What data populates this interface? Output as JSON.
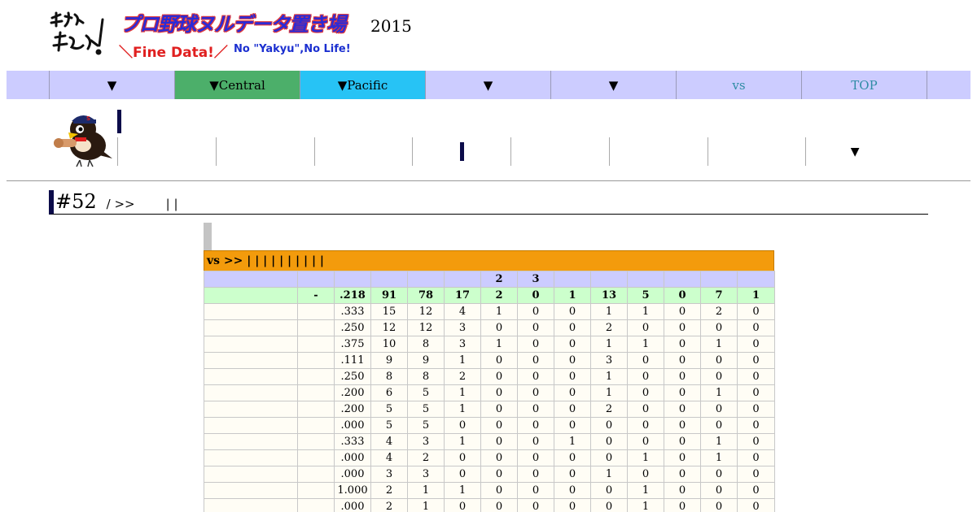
{
  "header": {
    "title": "プロ野球ヌルデータ置き場",
    "year": "2015",
    "slogan_fine": "＼Fine Data!／",
    "slogan_yakyu": "No \"Yakyu\",No Life!",
    "logo_icon": "calligraphy-logo"
  },
  "nav": {
    "items": [
      {
        "label": ""
      },
      {
        "label": "▼"
      },
      {
        "label": "▼Central",
        "color": "#4caf6a"
      },
      {
        "label": "▼Pacific",
        "color": "#27c3f5"
      },
      {
        "label": "▼"
      },
      {
        "label": "▼"
      },
      {
        "label": "vs"
      },
      {
        "label": "TOP"
      },
      {
        "label": ""
      }
    ]
  },
  "team_bar": {
    "mascot_icon": "swallow-mascot-icon",
    "tabs": [
      "",
      "",
      "",
      "",
      "",
      "",
      "",
      ""
    ],
    "dropdown_label": "▼"
  },
  "player": {
    "number": "#52",
    "sub": "/ >>",
    "links": "| |"
  },
  "table": {
    "caption": "vs >> | | | | | | | | | |",
    "header_row": [
      "",
      "",
      "",
      "",
      "",
      "",
      "2",
      "3",
      "",
      "",
      "",
      "",
      "",
      ""
    ],
    "total_row": [
      "",
      "-",
      ".218",
      "91",
      "78",
      "17",
      "2",
      "0",
      "1",
      "13",
      "5",
      "0",
      "7",
      "1"
    ],
    "rows": [
      [
        "",
        "",
        ".333",
        "15",
        "12",
        "4",
        "1",
        "0",
        "0",
        "1",
        "1",
        "0",
        "2",
        "0"
      ],
      [
        "",
        "",
        ".250",
        "12",
        "12",
        "3",
        "0",
        "0",
        "0",
        "2",
        "0",
        "0",
        "0",
        "0"
      ],
      [
        "",
        "",
        ".375",
        "10",
        "8",
        "3",
        "1",
        "0",
        "0",
        "1",
        "1",
        "0",
        "1",
        "0"
      ],
      [
        "",
        "",
        ".111",
        "9",
        "9",
        "1",
        "0",
        "0",
        "0",
        "3",
        "0",
        "0",
        "0",
        "0"
      ],
      [
        "",
        "",
        ".250",
        "8",
        "8",
        "2",
        "0",
        "0",
        "0",
        "1",
        "0",
        "0",
        "0",
        "0"
      ],
      [
        "",
        "",
        ".200",
        "6",
        "5",
        "1",
        "0",
        "0",
        "0",
        "1",
        "0",
        "0",
        "1",
        "0"
      ],
      [
        "",
        "",
        ".200",
        "5",
        "5",
        "1",
        "0",
        "0",
        "0",
        "2",
        "0",
        "0",
        "0",
        "0"
      ],
      [
        "",
        "",
        ".000",
        "5",
        "5",
        "0",
        "0",
        "0",
        "0",
        "0",
        "0",
        "0",
        "0",
        "0"
      ],
      [
        "",
        "",
        ".333",
        "4",
        "3",
        "1",
        "0",
        "0",
        "1",
        "0",
        "0",
        "0",
        "1",
        "0"
      ],
      [
        "",
        "",
        ".000",
        "4",
        "2",
        "0",
        "0",
        "0",
        "0",
        "0",
        "1",
        "0",
        "1",
        "0"
      ],
      [
        "",
        "",
        ".000",
        "3",
        "3",
        "0",
        "0",
        "0",
        "0",
        "1",
        "0",
        "0",
        "0",
        "0"
      ],
      [
        "",
        "",
        "1.000",
        "2",
        "1",
        "1",
        "0",
        "0",
        "0",
        "0",
        "1",
        "0",
        "0",
        "0"
      ],
      [
        "",
        "",
        ".000",
        "2",
        "1",
        "0",
        "0",
        "0",
        "0",
        "0",
        "1",
        "0",
        "0",
        "0"
      ]
    ]
  }
}
